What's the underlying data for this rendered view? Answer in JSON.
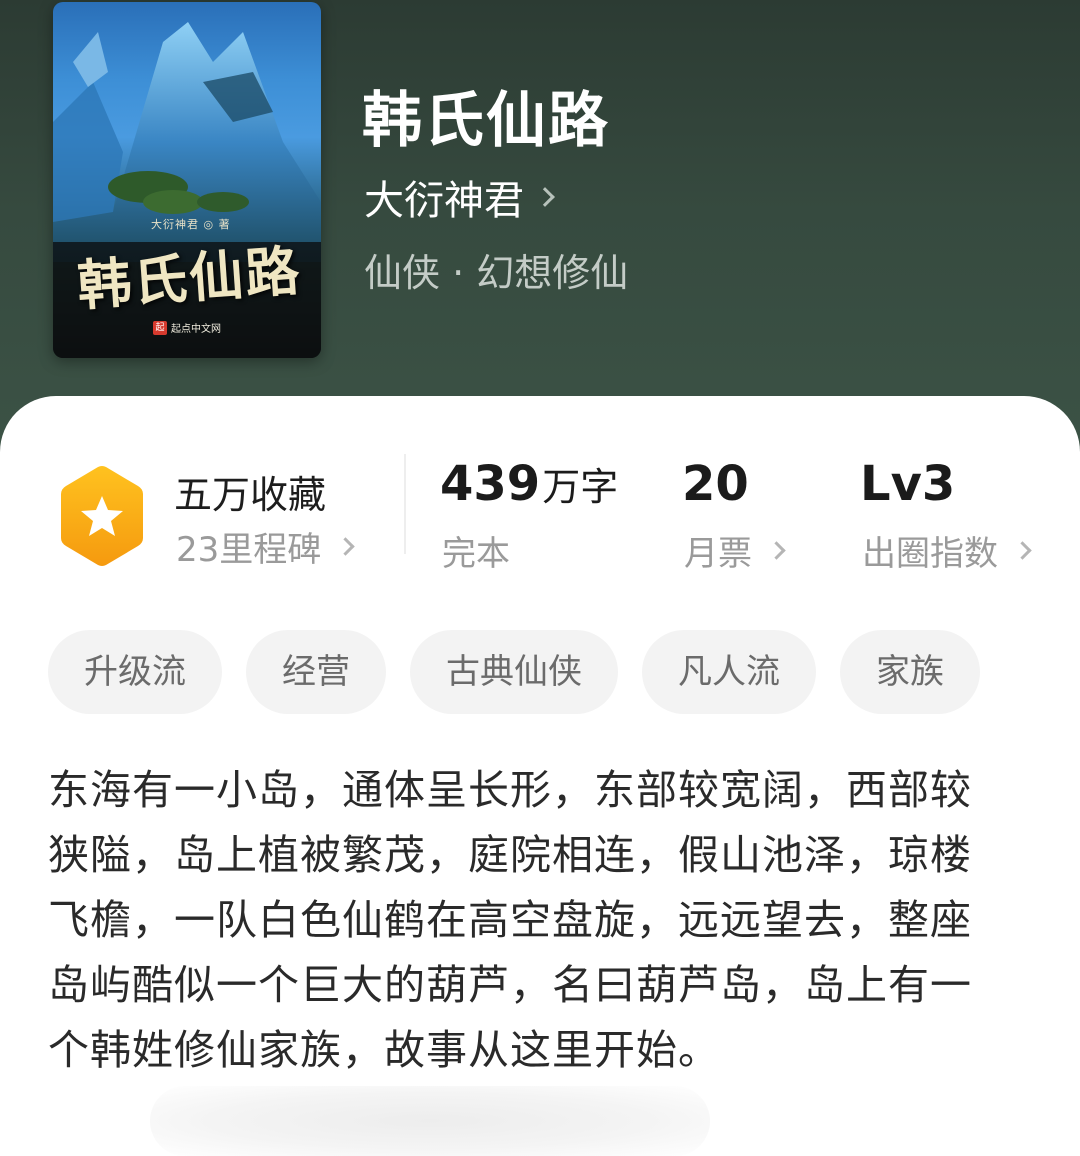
{
  "book": {
    "title": "韩氏仙路",
    "author": "大衍神君",
    "genre": "仙侠 · 幻想修仙",
    "cover": {
      "title": "韩氏仙路",
      "author_line": "大衍神君 ◎ 著",
      "publisher": "起点中文网",
      "publisher_logo": "起"
    }
  },
  "stats": {
    "collection": {
      "label": "五万收藏",
      "sub": "23里程碑"
    },
    "words": {
      "value": "439",
      "unit": "万字",
      "sub": "完本"
    },
    "monthly_ticket": {
      "value": "20",
      "sub": "月票"
    },
    "influence": {
      "value": "Lv3",
      "sub": "出圈指数"
    }
  },
  "tags": [
    "升级流",
    "经营",
    "古典仙侠",
    "凡人流",
    "家族"
  ],
  "description": "东海有一小岛，通体呈长形，东部较宽阔，西部较狭隘，岛上植被繁茂，庭院相连，假山池泽，琼楼飞檐，一队白色仙鹤在高空盘旋，远远望去，整座岛屿酷似一个巨大的葫芦，名曰葫芦岛，岛上有一个韩姓修仙家族，故事从这里开始。",
  "colors": {
    "header_bg": "#364a3f",
    "badge": "#f7a416",
    "tag_bg": "#f3f3f3",
    "text_main": "#1d1d1d",
    "text_sub": "#9a9a9a"
  },
  "icons": {
    "badge": "star-hexagon-icon",
    "chevron": "chevron-right-icon"
  }
}
